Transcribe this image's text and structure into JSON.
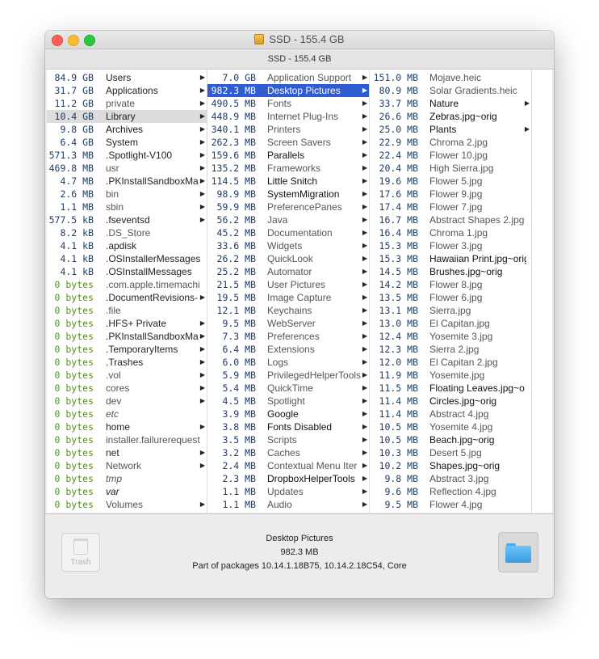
{
  "window": {
    "title": "SSD - 155.4 GB"
  },
  "pathbar": {
    "label": "SSD - 155.4 GB"
  },
  "columns": [
    {
      "items": [
        {
          "size": "84.9 GB",
          "name": "Users",
          "folder": true,
          "style": "normal"
        },
        {
          "size": "31.7 GB",
          "name": "Applications",
          "folder": true,
          "style": "normal"
        },
        {
          "size": "11.2 GB",
          "name": "private",
          "folder": true,
          "style": "gray"
        },
        {
          "size": "10.4 GB",
          "name": "Library",
          "folder": true,
          "style": "normal",
          "selected": "gray"
        },
        {
          "size": "9.8 GB",
          "name": "Archives",
          "folder": true,
          "style": "dark"
        },
        {
          "size": "6.4 GB",
          "name": "System",
          "folder": true,
          "style": "normal"
        },
        {
          "size": "571.3 MB",
          "name": ".Spotlight-V100",
          "folder": true,
          "style": "normal"
        },
        {
          "size": "469.8 MB",
          "name": "usr",
          "folder": true,
          "style": "gray"
        },
        {
          "size": "4.7 MB",
          "name": ".PKInstallSandboxMa",
          "folder": true,
          "style": "normal"
        },
        {
          "size": "2.6 MB",
          "name": "bin",
          "folder": true,
          "style": "gray"
        },
        {
          "size": "1.1 MB",
          "name": "sbin",
          "folder": true,
          "style": "gray"
        },
        {
          "size": "577.5 kB",
          "name": ".fseventsd",
          "folder": true,
          "style": "normal"
        },
        {
          "size": "8.2 kB",
          "name": ".DS_Store",
          "folder": false,
          "style": "gray"
        },
        {
          "size": "4.1 kB",
          "name": ".apdisk",
          "folder": false,
          "style": "normal"
        },
        {
          "size": "4.1 kB",
          "name": ".OSInstallerMessages",
          "folder": false,
          "style": "normal"
        },
        {
          "size": "4.1 kB",
          "name": ".OSInstallMessages",
          "folder": false,
          "style": "normal"
        },
        {
          "size": "0 bytes",
          "name": ".com.apple.timemachi",
          "folder": false,
          "style": "gray"
        },
        {
          "size": "0 bytes",
          "name": ".DocumentRevisions-",
          "folder": true,
          "style": "normal"
        },
        {
          "size": "0 bytes",
          "name": ".file",
          "folder": false,
          "style": "gray"
        },
        {
          "size": "0 bytes",
          "name": ".HFS+ Private",
          "folder": true,
          "style": "normal"
        },
        {
          "size": "0 bytes",
          "name": ".PKInstallSandboxMa",
          "folder": true,
          "style": "normal"
        },
        {
          "size": "0 bytes",
          "name": ".TemporaryItems",
          "folder": true,
          "style": "normal"
        },
        {
          "size": "0 bytes",
          "name": ".Trashes",
          "folder": true,
          "style": "normal"
        },
        {
          "size": "0 bytes",
          "name": ".vol",
          "folder": true,
          "style": "gray"
        },
        {
          "size": "0 bytes",
          "name": "cores",
          "folder": true,
          "style": "gray"
        },
        {
          "size": "0 bytes",
          "name": "dev",
          "folder": true,
          "style": "gray"
        },
        {
          "size": "0 bytes",
          "name": "etc",
          "folder": false,
          "style": "gray-italic"
        },
        {
          "size": "0 bytes",
          "name": "home",
          "folder": true,
          "style": "normal"
        },
        {
          "size": "0 bytes",
          "name": "installer.failurerequest",
          "folder": false,
          "style": "gray"
        },
        {
          "size": "0 bytes",
          "name": "net",
          "folder": true,
          "style": "normal"
        },
        {
          "size": "0 bytes",
          "name": "Network",
          "folder": true,
          "style": "gray"
        },
        {
          "size": "0 bytes",
          "name": "tmp",
          "folder": false,
          "style": "gray-italic"
        },
        {
          "size": "0 bytes",
          "name": "var",
          "folder": false,
          "style": "italic"
        },
        {
          "size": "0 bytes",
          "name": "Volumes",
          "folder": true,
          "style": "gray"
        }
      ]
    },
    {
      "items": [
        {
          "size": "7.0 GB",
          "name": "Application Support",
          "folder": true,
          "style": "gray"
        },
        {
          "size": "982.3 MB",
          "name": "Desktop Pictures",
          "folder": true,
          "style": "normal",
          "selected": "blue"
        },
        {
          "size": "490.5 MB",
          "name": "Fonts",
          "folder": true,
          "style": "gray"
        },
        {
          "size": "448.9 MB",
          "name": "Internet Plug-Ins",
          "folder": true,
          "style": "gray"
        },
        {
          "size": "340.1 MB",
          "name": "Printers",
          "folder": true,
          "style": "gray"
        },
        {
          "size": "262.3 MB",
          "name": "Screen Savers",
          "folder": true,
          "style": "gray"
        },
        {
          "size": "159.6 MB",
          "name": "Parallels",
          "folder": true,
          "style": "dark"
        },
        {
          "size": "135.2 MB",
          "name": "Frameworks",
          "folder": true,
          "style": "gray"
        },
        {
          "size": "114.5 MB",
          "name": "Little Snitch",
          "folder": true,
          "style": "dark"
        },
        {
          "size": "98.9 MB",
          "name": "SystemMigration",
          "folder": true,
          "style": "dark"
        },
        {
          "size": "59.9 MB",
          "name": "PreferencePanes",
          "folder": true,
          "style": "gray"
        },
        {
          "size": "56.2 MB",
          "name": "Java",
          "folder": true,
          "style": "gray"
        },
        {
          "size": "45.2 MB",
          "name": "Documentation",
          "folder": true,
          "style": "gray"
        },
        {
          "size": "33.6 MB",
          "name": "Widgets",
          "folder": true,
          "style": "gray"
        },
        {
          "size": "26.2 MB",
          "name": "QuickLook",
          "folder": true,
          "style": "gray"
        },
        {
          "size": "25.2 MB",
          "name": "Automator",
          "folder": true,
          "style": "gray"
        },
        {
          "size": "21.5 MB",
          "name": "User Pictures",
          "folder": true,
          "style": "gray"
        },
        {
          "size": "19.5 MB",
          "name": "Image Capture",
          "folder": true,
          "style": "gray"
        },
        {
          "size": "12.1 MB",
          "name": "Keychains",
          "folder": true,
          "style": "gray"
        },
        {
          "size": "9.5 MB",
          "name": "WebServer",
          "folder": true,
          "style": "gray"
        },
        {
          "size": "7.3 MB",
          "name": "Preferences",
          "folder": true,
          "style": "gray"
        },
        {
          "size": "6.4 MB",
          "name": "Extensions",
          "folder": true,
          "style": "gray"
        },
        {
          "size": "6.0 MB",
          "name": "Logs",
          "folder": true,
          "style": "gray"
        },
        {
          "size": "5.9 MB",
          "name": "PrivilegedHelperTools",
          "folder": true,
          "style": "gray"
        },
        {
          "size": "5.4 MB",
          "name": "QuickTime",
          "folder": true,
          "style": "gray"
        },
        {
          "size": "4.5 MB",
          "name": "Spotlight",
          "folder": true,
          "style": "gray"
        },
        {
          "size": "3.9 MB",
          "name": "Google",
          "folder": true,
          "style": "dark"
        },
        {
          "size": "3.8 MB",
          "name": "Fonts Disabled",
          "folder": true,
          "style": "dark"
        },
        {
          "size": "3.5 MB",
          "name": "Scripts",
          "folder": true,
          "style": "gray"
        },
        {
          "size": "3.2 MB",
          "name": "Caches",
          "folder": true,
          "style": "gray"
        },
        {
          "size": "2.4 MB",
          "name": "Contextual Menu Iter",
          "folder": true,
          "style": "gray"
        },
        {
          "size": "2.3 MB",
          "name": "DropboxHelperTools",
          "folder": true,
          "style": "dark"
        },
        {
          "size": "1.1 MB",
          "name": "Updates",
          "folder": true,
          "style": "gray"
        },
        {
          "size": "1.1 MB",
          "name": "Audio",
          "folder": true,
          "style": "gray"
        }
      ]
    },
    {
      "items": [
        {
          "size": "151.0 MB",
          "name": "Mojave.heic",
          "folder": false,
          "style": "gray"
        },
        {
          "size": "80.9 MB",
          "name": "Solar Gradients.heic",
          "folder": false,
          "style": "gray"
        },
        {
          "size": "33.7 MB",
          "name": "Nature",
          "folder": true,
          "style": "dark"
        },
        {
          "size": "26.6 MB",
          "name": "Zebras.jpg~orig",
          "folder": false,
          "style": "dark"
        },
        {
          "size": "25.0 MB",
          "name": "Plants",
          "folder": true,
          "style": "dark"
        },
        {
          "size": "22.9 MB",
          "name": "Chroma 2.jpg",
          "folder": false,
          "style": "gray"
        },
        {
          "size": "22.4 MB",
          "name": "Flower 10.jpg",
          "folder": false,
          "style": "gray"
        },
        {
          "size": "20.4 MB",
          "name": "High Sierra.jpg",
          "folder": false,
          "style": "gray"
        },
        {
          "size": "19.6 MB",
          "name": "Flower 5.jpg",
          "folder": false,
          "style": "gray"
        },
        {
          "size": "17.6 MB",
          "name": "Flower 9.jpg",
          "folder": false,
          "style": "gray"
        },
        {
          "size": "17.4 MB",
          "name": "Flower 7.jpg",
          "folder": false,
          "style": "gray"
        },
        {
          "size": "16.7 MB",
          "name": "Abstract Shapes 2.jpg",
          "folder": false,
          "style": "gray"
        },
        {
          "size": "16.4 MB",
          "name": "Chroma 1.jpg",
          "folder": false,
          "style": "gray"
        },
        {
          "size": "15.3 MB",
          "name": "Flower 3.jpg",
          "folder": false,
          "style": "gray"
        },
        {
          "size": "15.3 MB",
          "name": "Hawaiian Print.jpg~orig",
          "folder": false,
          "style": "dark"
        },
        {
          "size": "14.5 MB",
          "name": "Brushes.jpg~orig",
          "folder": false,
          "style": "dark"
        },
        {
          "size": "14.2 MB",
          "name": "Flower 8.jpg",
          "folder": false,
          "style": "gray"
        },
        {
          "size": "13.5 MB",
          "name": "Flower 6.jpg",
          "folder": false,
          "style": "gray"
        },
        {
          "size": "13.1 MB",
          "name": "Sierra.jpg",
          "folder": false,
          "style": "gray"
        },
        {
          "size": "13.0 MB",
          "name": "El Capitan.jpg",
          "folder": false,
          "style": "gray"
        },
        {
          "size": "12.4 MB",
          "name": "Yosemite 3.jpg",
          "folder": false,
          "style": "gray"
        },
        {
          "size": "12.3 MB",
          "name": "Sierra 2.jpg",
          "folder": false,
          "style": "gray"
        },
        {
          "size": "12.0 MB",
          "name": "El Capitan 2.jpg",
          "folder": false,
          "style": "gray"
        },
        {
          "size": "11.9 MB",
          "name": "Yosemite.jpg",
          "folder": false,
          "style": "gray"
        },
        {
          "size": "11.5 MB",
          "name": "Floating Leaves.jpg~o",
          "folder": false,
          "style": "dark"
        },
        {
          "size": "11.4 MB",
          "name": "Circles.jpg~orig",
          "folder": false,
          "style": "dark"
        },
        {
          "size": "11.4 MB",
          "name": "Abstract 4.jpg",
          "folder": false,
          "style": "gray"
        },
        {
          "size": "10.5 MB",
          "name": "Yosemite 4.jpg",
          "folder": false,
          "style": "gray"
        },
        {
          "size": "10.5 MB",
          "name": "Beach.jpg~orig",
          "folder": false,
          "style": "dark"
        },
        {
          "size": "10.3 MB",
          "name": "Desert 5.jpg",
          "folder": false,
          "style": "gray"
        },
        {
          "size": "10.2 MB",
          "name": "Shapes.jpg~orig",
          "folder": false,
          "style": "dark"
        },
        {
          "size": "9.8 MB",
          "name": "Abstract 3.jpg",
          "folder": false,
          "style": "gray"
        },
        {
          "size": "9.6 MB",
          "name": "Reflection 4.jpg",
          "folder": false,
          "style": "gray"
        },
        {
          "size": "9.5 MB",
          "name": "Flower 4.jpg",
          "folder": false,
          "style": "gray"
        }
      ]
    }
  ],
  "footer": {
    "trash_label": "Trash",
    "selected_name": "Desktop Pictures",
    "selected_size": "982.3 MB",
    "packages": "Part of packages 10.14.1.18B75, 10.14.2.18C54, Core",
    "folder_icon": "folder-icon"
  },
  "colors": {
    "selection_blue": "#2f5bd3",
    "selection_gray": "#dcdcdc",
    "size_blue": "#1f3c66",
    "size_zero_green": "#4f8f1a"
  }
}
